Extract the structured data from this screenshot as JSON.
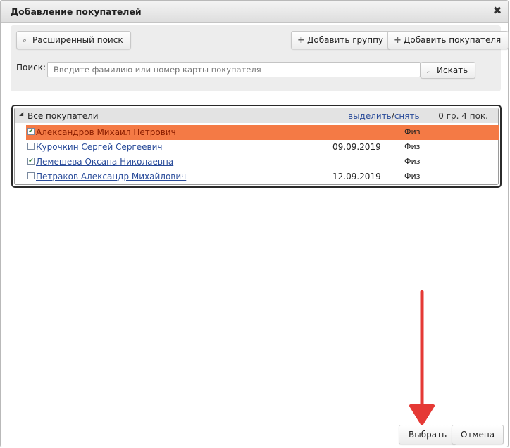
{
  "dialog": {
    "title": "Добавление покупателей",
    "close_glyph": "✖"
  },
  "toolbar": {
    "advanced_search_label": "Расширенный поиск",
    "add_group_label": "Добавить группу",
    "add_customer_label": "Добавить покупателя"
  },
  "search": {
    "label": "Поиск:",
    "placeholder": "Введите фамилию или номер карты покупателя",
    "value": "",
    "button_label": "Искать"
  },
  "tree": {
    "root_label": "Все покупатели",
    "select_link": "выделить",
    "separator": "/",
    "deselect_link": "снять",
    "count_text": "0 гр. 4 пок.",
    "rows": [
      {
        "name": "Александров Михаил Петрович",
        "date": "",
        "type": "Физ",
        "checked": true,
        "check_glyph": "✔",
        "selected": true
      },
      {
        "name": "Курочкин Сергей Сергеевич",
        "date": "09.09.2019",
        "type": "Физ",
        "checked": false,
        "check_glyph": "",
        "selected": false
      },
      {
        "name": "Лемешева Оксана Николаевна",
        "date": "",
        "type": "Физ",
        "checked": true,
        "check_glyph": "✔",
        "selected": false
      },
      {
        "name": "Петраков Александр Михайлович",
        "date": "12.09.2019",
        "type": "Физ",
        "checked": false,
        "check_glyph": "",
        "selected": false
      }
    ]
  },
  "footer": {
    "select_label": "Выбрать",
    "cancel_label": "Отмена"
  },
  "colors": {
    "selected_row": "#f47a45",
    "annotation_arrow": "#e53935"
  }
}
